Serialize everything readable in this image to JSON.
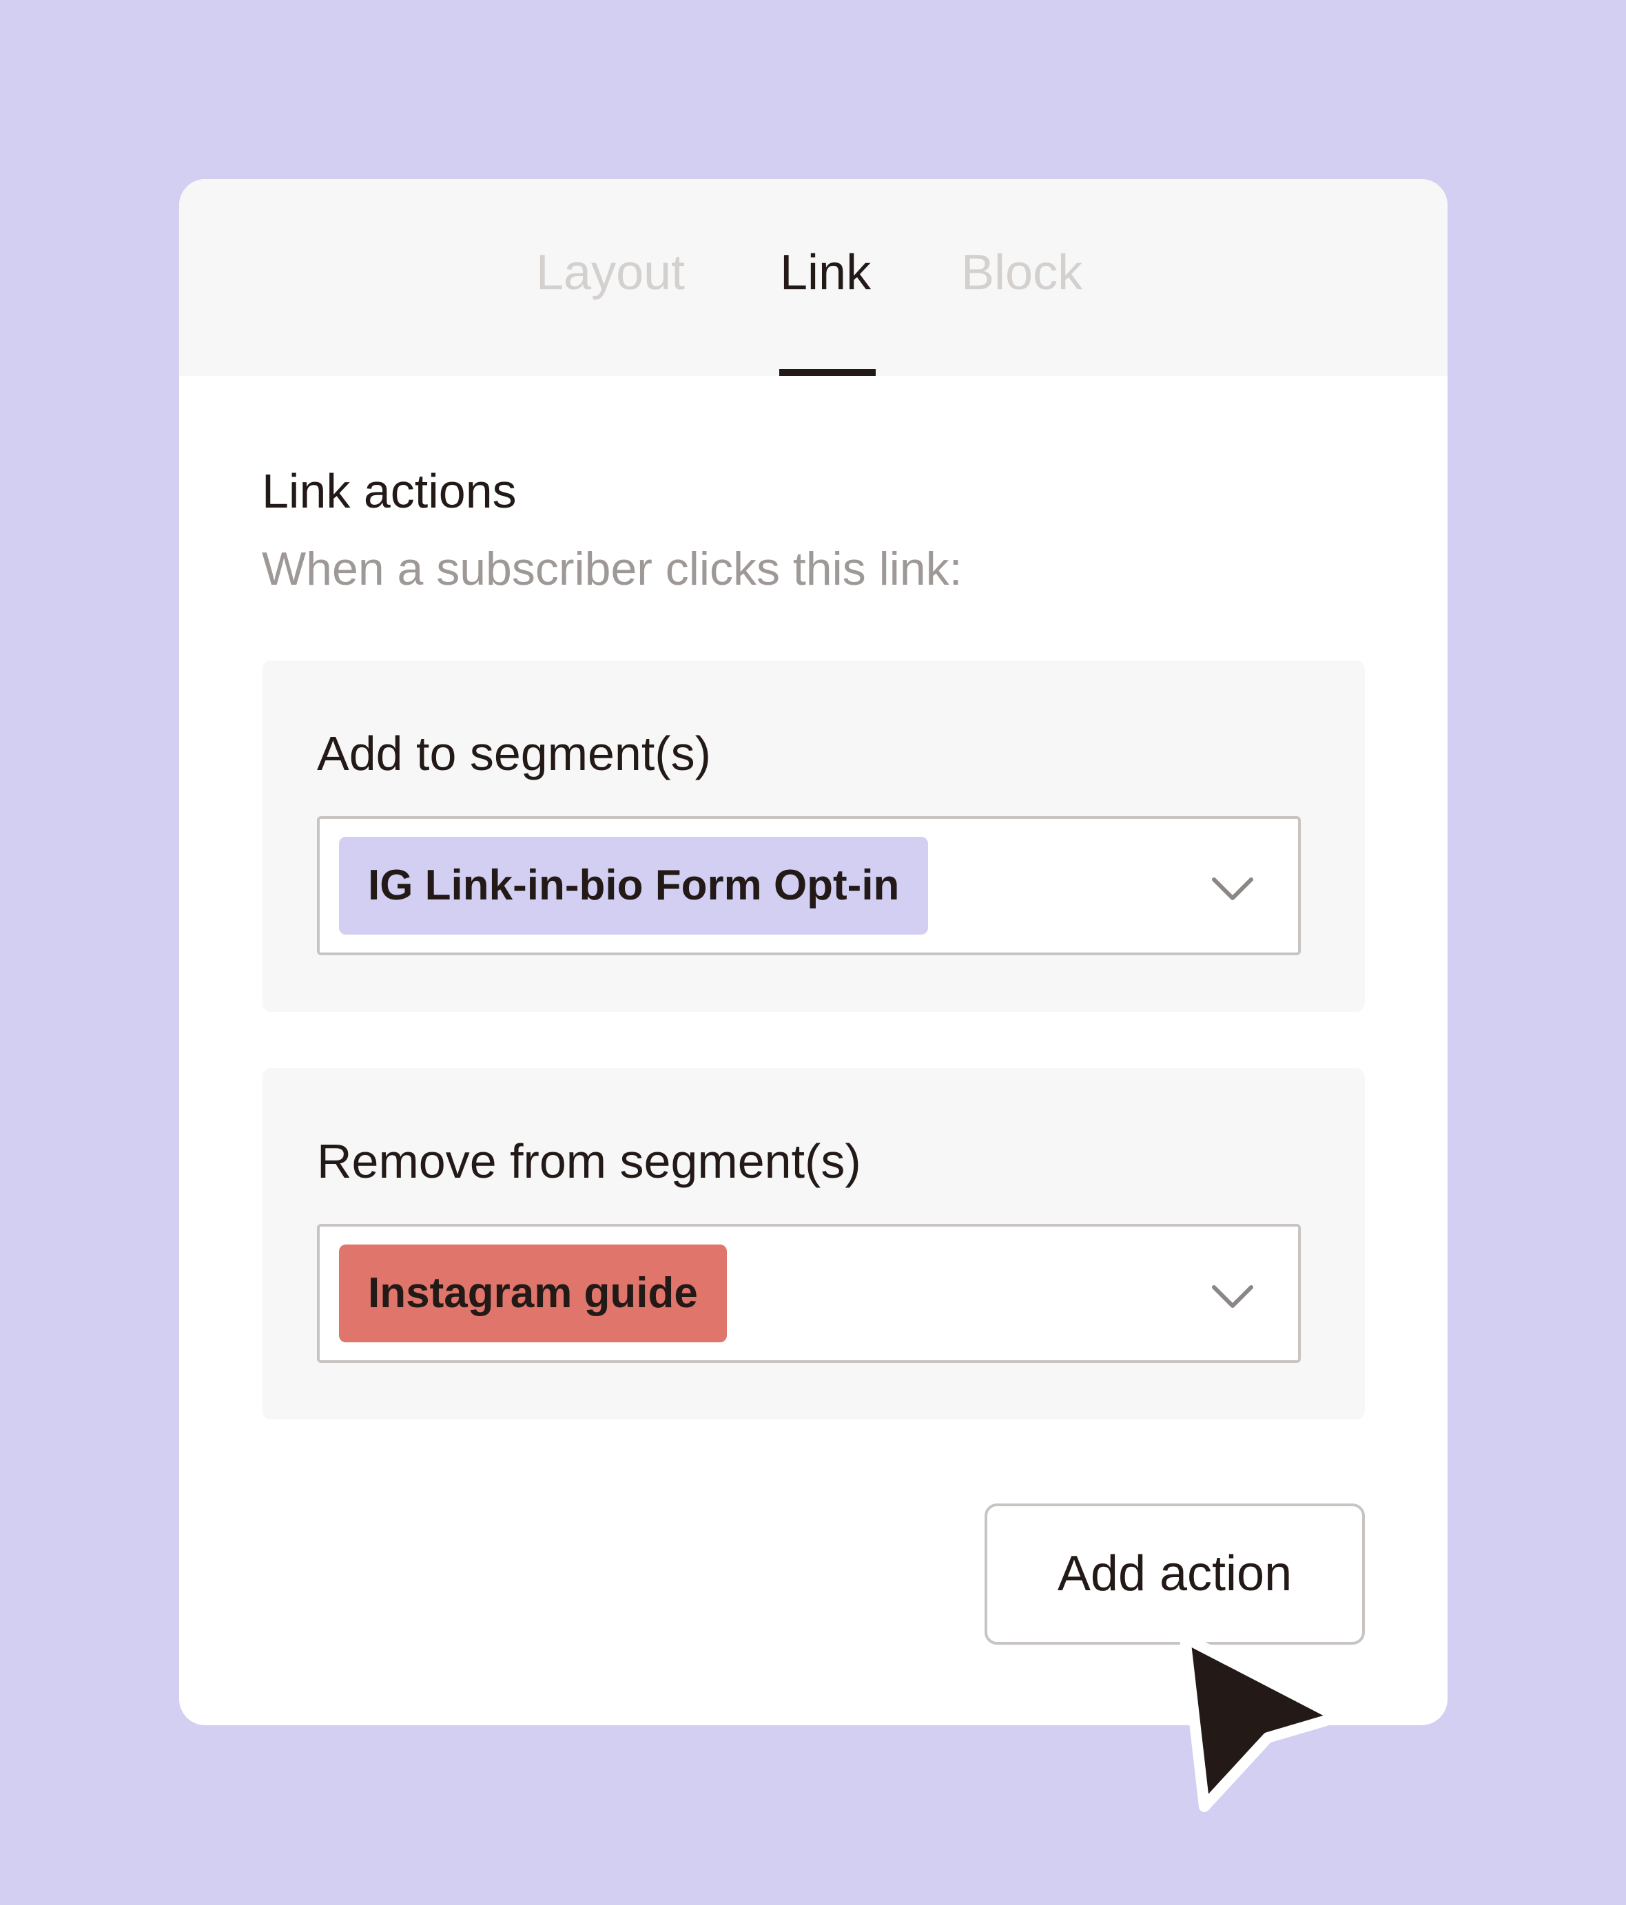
{
  "tabs": {
    "layout": "Layout",
    "link": "Link",
    "block": "Block",
    "active": "Link"
  },
  "link_actions": {
    "title": "Link actions",
    "subtitle": "When a subscriber clicks this link:"
  },
  "add_segment": {
    "label": "Add to segment(s)",
    "selected": "IG Link-in-bio Form Opt-in",
    "chip_color": "#d2cff3"
  },
  "remove_segment": {
    "label": "Remove from segment(s)",
    "selected": "Instagram guide",
    "chip_color": "#e0756b"
  },
  "add_action_button": "Add action",
  "icons": {
    "dropdown": "chevron-down-icon",
    "pointer": "cursor-arrow-icon"
  },
  "colors": {
    "background": "#d2cff3",
    "text": "#231a18",
    "muted_text": "#9e9896",
    "inactive_tab": "#d4d0ce"
  }
}
